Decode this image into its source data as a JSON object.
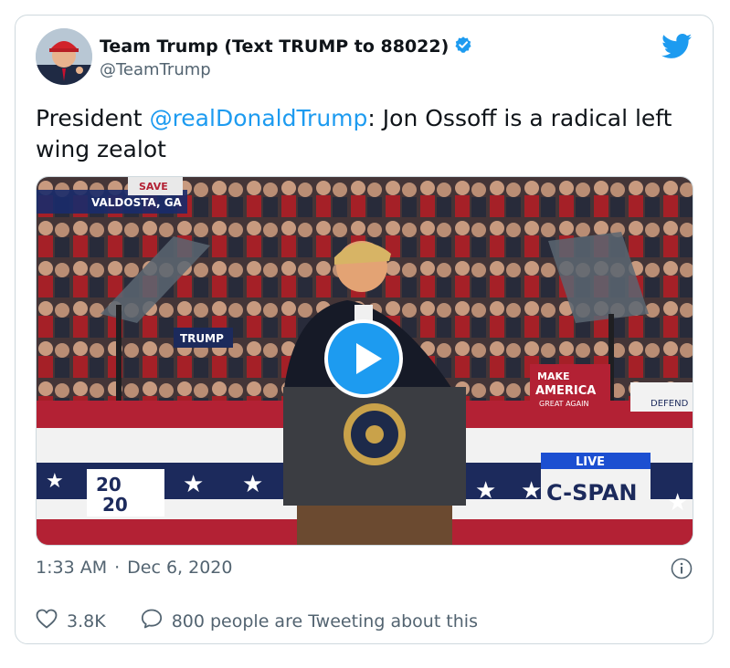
{
  "tweet": {
    "author": {
      "display_name": "Team Trump (Text TRUMP to 88022)",
      "handle": "@TeamTrump",
      "verified": true
    },
    "text_prefix": "President ",
    "mention": "@realDonaldTrump",
    "text_suffix": ": Jon Ossoff is a radical left wing zealot",
    "media": {
      "type": "video",
      "location_caption": "VALDOSTA, GA",
      "live_label": "LIVE",
      "network": "C-SPAN",
      "badge_top": "20",
      "badge_bottom": "20",
      "sign_line1": "MAKE",
      "sign_line2": "AMERICA",
      "sign_line3": "GREAT AGAIN",
      "sign_fragment": "DEFEND",
      "save_fragment": "SAVE",
      "trump_fragment": "TRUMP"
    },
    "time": "1:33 AM",
    "separator": "·",
    "date": "Dec 6, 2020",
    "likes": "3.8K",
    "conversation": "800 people are Tweeting about this"
  },
  "icons": {
    "brand": "twitter-bird-icon",
    "verified": "verified-badge-icon",
    "info": "info-icon",
    "like": "heart-icon",
    "reply": "speech-bubble-icon",
    "play": "play-icon"
  },
  "colors": {
    "accent": "#1d9bf0",
    "text": "#0f1419",
    "muted": "#536471",
    "border": "#cfd9de"
  }
}
